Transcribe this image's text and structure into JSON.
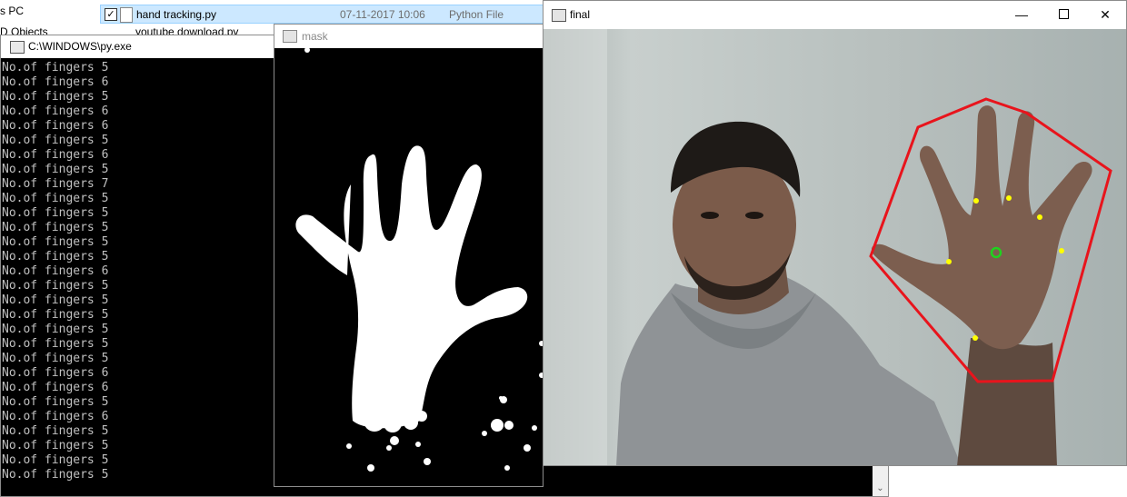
{
  "explorer": {
    "nav_items": [
      "s PC",
      "D Objects"
    ],
    "selected_file": {
      "name": "hand tracking.py",
      "date": "07-11-2017 10:06",
      "type": "Python File",
      "checked": "✓"
    },
    "next_file_name": "youtube download.py"
  },
  "console": {
    "title": "C:\\WINDOWS\\py.exe",
    "lines": [
      "No.of fingers 5",
      "No.of fingers 6",
      "No.of fingers 5",
      "No.of fingers 6",
      "No.of fingers 6",
      "No.of fingers 5",
      "No.of fingers 6",
      "No.of fingers 5",
      "No.of fingers 7",
      "No.of fingers 5",
      "No.of fingers 5",
      "No.of fingers 5",
      "No.of fingers 5",
      "No.of fingers 5",
      "No.of fingers 6",
      "No.of fingers 5",
      "No.of fingers 5",
      "No.of fingers 5",
      "No.of fingers 5",
      "No.of fingers 5",
      "No.of fingers 5",
      "No.of fingers 6",
      "No.of fingers 6",
      "No.of fingers 5",
      "No.of fingers 6",
      "No.of fingers 5",
      "No.of fingers 5",
      "No.of fingers 5",
      "No.of fingers 5"
    ],
    "scroll_arrow": "⌄"
  },
  "mask_window": {
    "title": "mask"
  },
  "final_window": {
    "title": "final",
    "minimize": "—",
    "close": "✕",
    "hull_color": "#e8141c",
    "defect_color": "#ffff00",
    "centroid_color": "#1fd21f"
  }
}
